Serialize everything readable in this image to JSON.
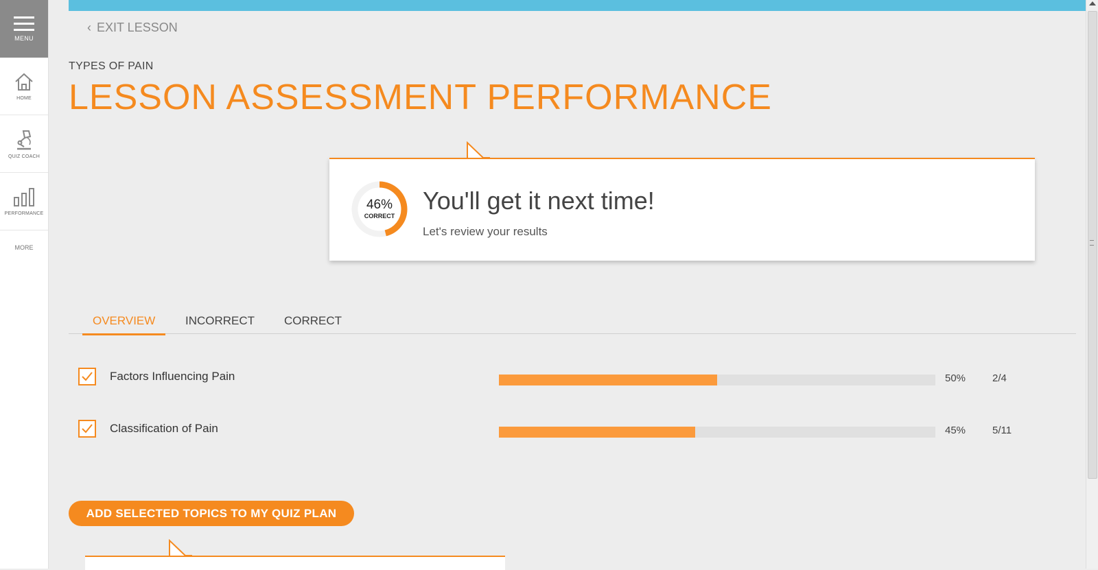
{
  "sidebar": {
    "menu_label": "MENU",
    "items": [
      {
        "label": "HOME",
        "icon": "home-icon"
      },
      {
        "label": "QUIZ COACH",
        "icon": "quiz-coach-icon"
      },
      {
        "label": "PERFORMANCE",
        "icon": "performance-icon"
      }
    ],
    "more_label": "MORE"
  },
  "header": {
    "exit_label": "EXIT LESSON",
    "subtitle": "TYPES OF PAIN",
    "title": "LESSON ASSESSMENT PERFORMANCE"
  },
  "result": {
    "percent_text": "46%",
    "percent_value": 46,
    "percent_label": "CORRECT",
    "headline": "You'll get it next time!",
    "subline": "Let's review your results"
  },
  "tabs": [
    {
      "label": "OVERVIEW",
      "active": true
    },
    {
      "label": "INCORRECT",
      "active": false
    },
    {
      "label": "CORRECT",
      "active": false
    }
  ],
  "topics": [
    {
      "name": "Factors Influencing Pain",
      "percent_text": "50%",
      "progress": 0.5,
      "ratio": "2/4",
      "checked": true
    },
    {
      "name": "Classification of Pain",
      "percent_text": "45%",
      "progress": 0.45,
      "ratio": "5/11",
      "checked": true
    }
  ],
  "add_button_label": "ADD SELECTED TOPICS TO MY QUIZ PLAN",
  "colors": {
    "accent": "#f58a1f",
    "bar_fill": "#fb9a3c",
    "top_bar": "#5bbfdf",
    "menu_bg": "#8a8a8a"
  }
}
